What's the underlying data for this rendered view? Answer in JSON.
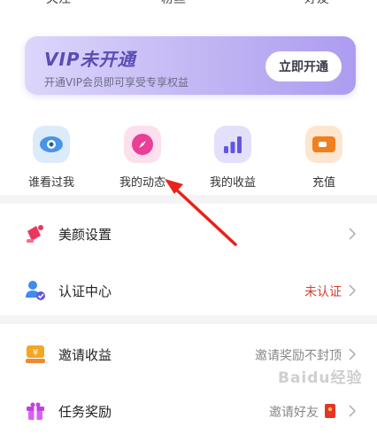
{
  "top_tabs": [
    "关注",
    "粉丝",
    "好友"
  ],
  "vip": {
    "title": "VIP未开通",
    "subtitle": "开通VIP会员即可享受专享权益",
    "button": "立即开通"
  },
  "shortcuts": [
    {
      "label": "谁看过我",
      "icon": "eye-icon",
      "color": "#5aa3ee"
    },
    {
      "label": "我的动态",
      "icon": "compass-icon",
      "color": "#ee4fa0"
    },
    {
      "label": "我的收益",
      "icon": "bar-chart-icon",
      "color": "#6a5ee8"
    },
    {
      "label": "充值",
      "icon": "wallet-icon",
      "color": "#f08a30"
    }
  ],
  "menu_group1": [
    {
      "label": "美颜设置",
      "value": "",
      "icon": "beauty-icon"
    },
    {
      "label": "认证中心",
      "value": "未认证",
      "icon": "verify-user-icon",
      "value_color": "#d8402f"
    }
  ],
  "menu_group2": [
    {
      "label": "邀请收益",
      "value": "邀请奖励不封顶",
      "icon": "invite-income-icon"
    },
    {
      "label": "任务奖励",
      "value": "邀请好友",
      "icon": "gift-icon"
    }
  ],
  "watermark": "Baidu经验"
}
